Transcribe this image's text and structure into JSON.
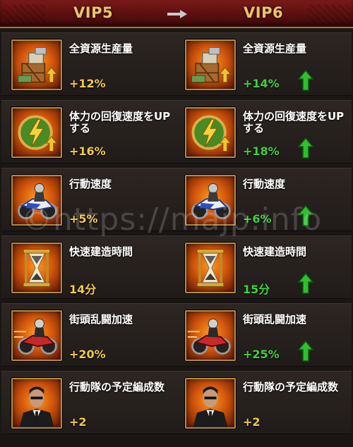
{
  "header": {
    "left_label": "VIP5",
    "right_label": "VIP6",
    "arrow_icon": "arrow-right-icon"
  },
  "rows": [
    {
      "icon": "resource-crate-icon",
      "left": {
        "title": "全資源生産量",
        "value": "+12%"
      },
      "right": {
        "title": "全資源生産量",
        "value": "+14%",
        "upgraded": true
      }
    },
    {
      "icon": "stamina-lightning-icon",
      "left": {
        "title": "体力の回復速度をUPする",
        "value": "+16%"
      },
      "right": {
        "title": "体力の回復速度をUPする",
        "value": "+18%",
        "upgraded": true
      }
    },
    {
      "icon": "motorcycle-rider-icon",
      "left": {
        "title": "行動速度",
        "value": "+5%"
      },
      "right": {
        "title": "行動速度",
        "value": "+6%",
        "upgraded": true
      }
    },
    {
      "icon": "hourglass-icon",
      "left": {
        "title": "快速建造時間",
        "value": "14分"
      },
      "right": {
        "title": "快速建造時間",
        "value": "15分",
        "upgraded": true
      }
    },
    {
      "icon": "street-race-bike-icon",
      "left": {
        "title": "街頭乱闘加速",
        "value": "+20%"
      },
      "right": {
        "title": "街頭乱闘加速",
        "value": "+25%",
        "upgraded": true
      }
    },
    {
      "icon": "squad-leader-portrait-icon",
      "left": {
        "title": "行動隊の予定編成数",
        "value": "+2"
      },
      "right": {
        "title": "行動隊の予定編成数",
        "value": "+2",
        "upgraded": false
      }
    }
  ],
  "watermark": "©https://majp.info",
  "colors": {
    "header_red": "#5a0f0f",
    "gold_text": "#e8c46a",
    "value_yellow": "#f2c94c",
    "upgrade_green": "#3ed13e"
  }
}
